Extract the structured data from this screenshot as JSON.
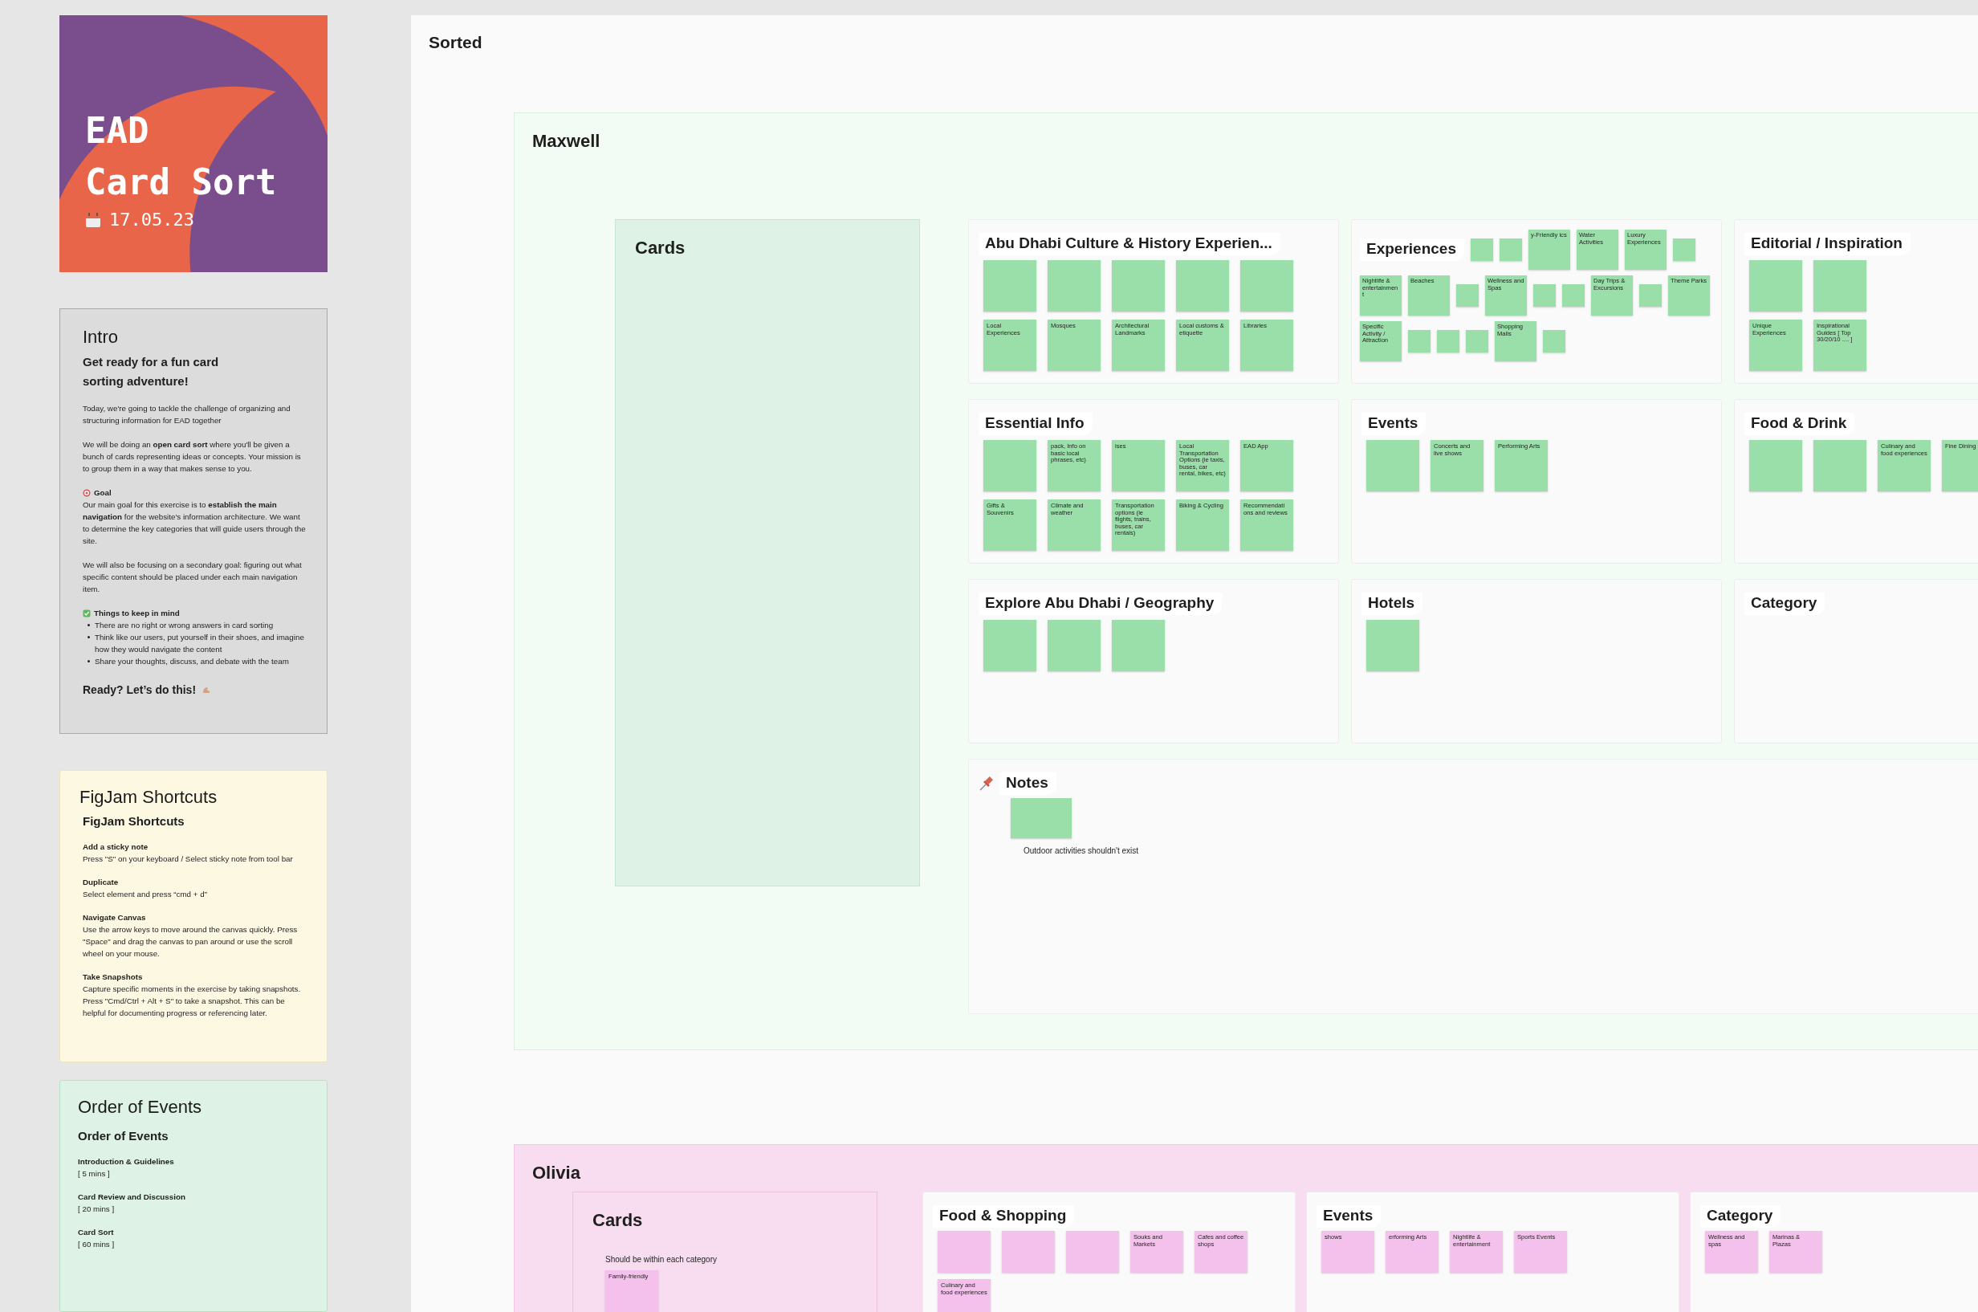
{
  "cover": {
    "title_lines": [
      "EAD",
      "Card Sort"
    ],
    "date": "17.05.23"
  },
  "intro": {
    "title": "Intro",
    "heading": "Get ready for a fun card sorting adventure!",
    "blocks": [
      {
        "kind": "para",
        "text": "Today, we're going to tackle the challenge of organizing and structuring information for EAD together"
      },
      {
        "kind": "para",
        "text": "We will be doing an **open card sort** where you'll be given a bunch of cards representing ideas or concepts. Your mission is to group them in a way that makes sense to you."
      },
      {
        "kind": "goal-heading",
        "text": "Goal"
      },
      {
        "kind": "body",
        "text": "Our main goal for this exercise is to **establish the main navigation** for the website's information architecture. We want to determine the key categories that will guide users through the site."
      },
      {
        "kind": "para",
        "text": "We will also be focusing on a secondary goal: figuring out what specific content should be placed under each main navigation item."
      },
      {
        "kind": "list-heading",
        "text": "Things to keep in mind"
      },
      {
        "kind": "bullets",
        "items": [
          "There are no right or wrong answers in card sorting",
          "Think like our users, put yourself in their shoes, and imagine how they would navigate the content",
          "Share your thoughts, discuss, and debate with the team"
        ]
      },
      {
        "kind": "closing",
        "text": "Ready? Let’s do this!"
      }
    ]
  },
  "shortcuts": {
    "title": "FigJam Shortcuts",
    "heading": "FigJam Shortcuts",
    "items": [
      {
        "name": "Add a sticky note",
        "text": "Press \"S\" on your keyboard / Select sticky note from tool bar"
      },
      {
        "name": "Duplicate",
        "text": "Select element and press “cmd + d”"
      },
      {
        "name": "Navigate Canvas",
        "text": "Use the arrow keys to move around the canvas quickly. Press \"Space\" and drag the canvas to pan around or use the scroll wheel on your mouse."
      },
      {
        "name": "Take Snapshots",
        "text": "Capture specific moments in the exercise by taking snapshots. Press \"Cmd/Ctrl + Alt + S\" to take a snapshot. This can be helpful for documenting progress or referencing later."
      }
    ]
  },
  "order": {
    "title": "Order of Events",
    "heading": "Order of Events",
    "items": [
      {
        "name": "Introduction & Guidelines",
        "time": "[ 5 mins ]"
      },
      {
        "name": "Card Review and Discussion",
        "time": "[ 20 mins ]"
      },
      {
        "name": "Card Sort",
        "time": "[ 60 mins ]"
      }
    ]
  },
  "board": {
    "title": "Sorted",
    "groups": [
      {
        "name": "Maxwell",
        "kind": "green",
        "cards": {
          "title": "Cards"
        },
        "categories": [
          {
            "kind": "grid",
            "title": "Abu Dhabi Culture & History Experien...",
            "stickies": [
              {
                "kind": "blank"
              },
              {
                "kind": "blank"
              },
              {
                "kind": "blank"
              },
              {
                "kind": "blank"
              },
              {
                "kind": "blank"
              },
              {
                "kind": "text",
                "text": "Local Experiences"
              },
              {
                "kind": "text",
                "text": "Mosques"
              },
              {
                "kind": "text",
                "text": "Architectural Landmarks"
              },
              {
                "kind": "text",
                "text": "Local customs & etiquette"
              },
              {
                "kind": "text",
                "text": "Libraries"
              }
            ]
          },
          {
            "kind": "scatter",
            "title": "Experiences",
            "stickies": [
              {
                "kind": "blank"
              },
              {
                "kind": "blank"
              },
              {
                "kind": "text",
                "text": "y-Friendly ics"
              },
              {
                "kind": "text",
                "text": "Water Activities"
              },
              {
                "kind": "text",
                "text": "Luxury Experiences"
              },
              {
                "kind": "blank"
              },
              {
                "kind": "text",
                "text": "Nightlife & entertainment"
              },
              {
                "kind": "text",
                "text": "Beaches"
              },
              {
                "kind": "blank"
              },
              {
                "kind": "text",
                "text": "Wellness and Spas"
              },
              {
                "kind": "blank"
              },
              {
                "kind": "blank"
              },
              {
                "kind": "text",
                "text": "Day Trips & Excursions"
              },
              {
                "kind": "blank"
              },
              {
                "kind": "text",
                "text": "Theme Parks"
              },
              {
                "kind": "text",
                "text": "Specific Activity / Attraction"
              },
              {
                "kind": "blank"
              },
              {
                "kind": "blank"
              },
              {
                "kind": "blank"
              },
              {
                "kind": "text",
                "text": "Shopping Malls"
              },
              {
                "kind": "blank"
              }
            ]
          },
          {
            "kind": "grid",
            "title": "Editorial / Inspiration",
            "stickies": [
              {
                "kind": "blank"
              },
              {
                "kind": "blank"
              },
              {
                "kind": "text",
                "text": "Unique Experiences"
              },
              {
                "kind": "text",
                "text": "Inspirational Guides [ Top 30/20/10 .... ]"
              }
            ]
          },
          {
            "kind": "grid",
            "title": "Essential Info",
            "stickies": [
              {
                "kind": "blank"
              },
              {
                "kind": "text",
                "text": "pack, Info on basic local phrases, etc)"
              },
              {
                "kind": "text",
                "text": "ises"
              },
              {
                "kind": "text",
                "text": "Local Transportation Options (ie taxis, buses, car rental, bikes, etc)"
              },
              {
                "kind": "text",
                "text": "EAD App"
              },
              {
                "kind": "text",
                "text": "Gifts & Souvenirs"
              },
              {
                "kind": "text",
                "text": "Climate and weather"
              },
              {
                "kind": "text",
                "text": "Transportation options (ie flights, trains, buses, car rentals)"
              },
              {
                "kind": "text",
                "text": "Biking & Cycling"
              },
              {
                "kind": "text",
                "text": "Recommendati ons and reviews"
              }
            ]
          },
          {
            "kind": "grid",
            "title": "Events",
            "stickies": [
              {
                "kind": "blank"
              },
              {
                "kind": "text",
                "text": "Concerts and live shows"
              },
              {
                "kind": "text",
                "text": "Performing Arts"
              }
            ]
          },
          {
            "kind": "grid",
            "title": "Food & Drink",
            "stickies": [
              {
                "kind": "blank"
              },
              {
                "kind": "blank"
              },
              {
                "kind": "text",
                "text": "Culinary and food experiences"
              },
              {
                "kind": "text",
                "text": "Fine Dining"
              }
            ]
          },
          {
            "kind": "grid",
            "title": "Explore Abu Dhabi / Geography",
            "stickies": [
              {
                "kind": "blank"
              },
              {
                "kind": "blank"
              },
              {
                "kind": "blank"
              }
            ]
          },
          {
            "kind": "grid",
            "title": "Hotels",
            "stickies": [
              {
                "kind": "blank"
              }
            ]
          },
          {
            "kind": "grid",
            "title": "Category"
          },
          {
            "kind": "notes",
            "title": "Notes",
            "stickies": [
              {
                "kind": "blank"
              }
            ],
            "note": "Outdoor activities shouldn't exist"
          }
        ]
      },
      {
        "name": "Olivia",
        "kind": "pink",
        "cards": {
          "title": "Cards",
          "note": "Should be within each category",
          "stickies": [
            {
              "kind": "text",
              "text": "Family-friendly"
            }
          ]
        },
        "categories": [
          {
            "kind": "grid",
            "title": "Food & Shopping",
            "stickies": [
              {
                "kind": "blank"
              },
              {
                "kind": "blank"
              },
              {
                "kind": "blank"
              },
              {
                "kind": "text",
                "text": "Souks and Markets"
              },
              {
                "kind": "text",
                "text": "Cafes and coffee shops"
              },
              {
                "kind": "text",
                "text": "Culinary and food experiences"
              }
            ]
          },
          {
            "kind": "grid",
            "title": "Events",
            "stickies": [
              {
                "kind": "text",
                "text": "shows"
              },
              {
                "kind": "text",
                "text": "erforming Arts"
              },
              {
                "kind": "text",
                "text": "Nightlife & entertainment"
              },
              {
                "kind": "text",
                "text": "Sports Events"
              }
            ]
          },
          {
            "kind": "grid",
            "title": "Category",
            "stickies": [
              {
                "kind": "text",
                "text": "Wellness and spas"
              },
              {
                "kind": "text",
                "text": "Marinas & Plazas"
              }
            ]
          }
        ]
      }
    ]
  }
}
